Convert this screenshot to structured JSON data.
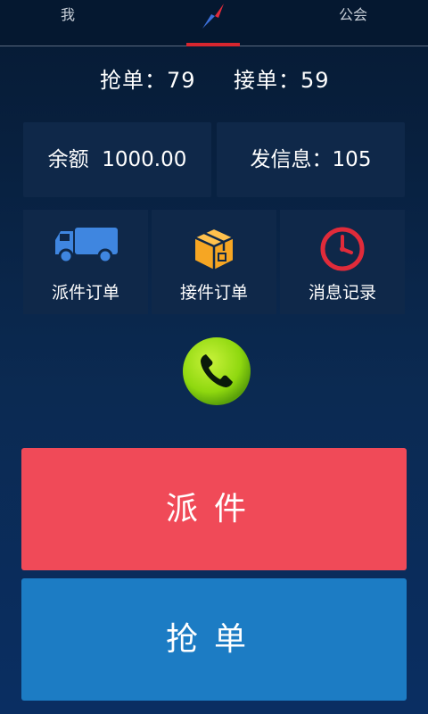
{
  "tabs": {
    "me": "我",
    "guild": "公会",
    "active": "compass"
  },
  "counts": {
    "grab": "抢单：79",
    "accept": "接单：59"
  },
  "stats": {
    "balance": "余额  1000.00",
    "messages": "发信息：105"
  },
  "shortcuts": {
    "dispatch_orders": "派件订单",
    "accept_orders": "接件订单",
    "message_records": "消息记录"
  },
  "actions": {
    "dispatch": "派件",
    "grab": "抢单"
  },
  "icons": {
    "compass": "compass-icon",
    "truck": "truck-icon",
    "package": "package-icon",
    "clock": "clock-icon",
    "phone": "phone-icon"
  },
  "colors": {
    "tab_indicator": "#d7262f",
    "dispatch_button": "#f04a58",
    "grab_button": "#1c7cc4",
    "truck": "#3f86e0",
    "package": "#f6a623",
    "clock": "#e02b3a",
    "phone": "#8fd80f"
  }
}
